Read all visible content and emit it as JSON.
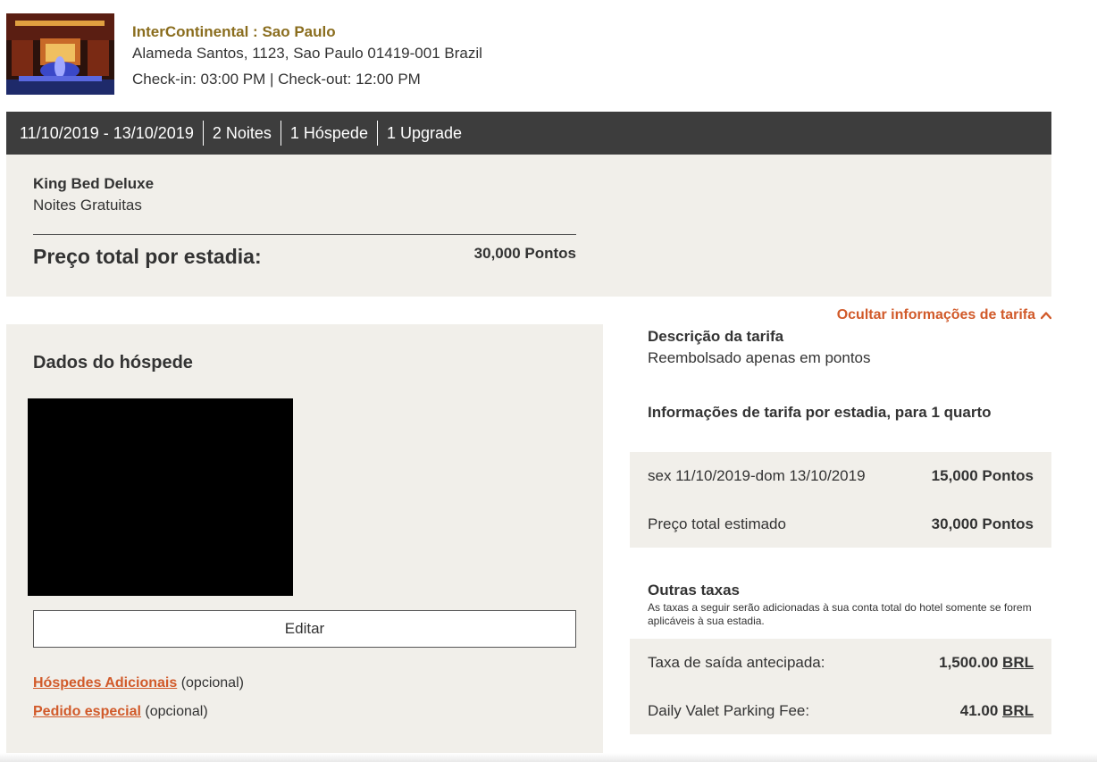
{
  "hotel": {
    "name": "InterContinental : Sao Paulo",
    "address": "Alameda Santos, 1123, Sao Paulo 01419-001 Brazil",
    "times": "Check-in: 03:00 PM | Check-out: 12:00 PM"
  },
  "stay": {
    "dates": "11/10/2019 - 13/10/2019",
    "nights": "2 Noites",
    "guests": "1 Hóspede",
    "upgrade": "1 Upgrade"
  },
  "room": {
    "name": "King Bed Deluxe",
    "rate": "Noites Gratuitas",
    "total_label": "Preço total por estadia:",
    "total_value": "30,000 Pontos"
  },
  "guest": {
    "title": "Dados do hóspede",
    "edit_label": "Editar",
    "additional_link": "Hóspedes Adicionais",
    "additional_note": "(opcional)",
    "special_link": "Pedido especial",
    "special_note": "(opcional)"
  },
  "rate_info": {
    "toggle_label": "Ocultar informações de tarifa",
    "desc_title": "Descrição da tarifa",
    "desc_text": "Reembolsado apenas em pontos",
    "info_title": "Informações de tarifa por estadia, para 1 quarto",
    "rows": [
      {
        "label": "sex 11/10/2019-dom 13/10/2019",
        "value": "15,000 Pontos"
      },
      {
        "label": "Preço total estimado",
        "value": "30,000 Pontos"
      }
    ]
  },
  "fees": {
    "title": "Outras taxas",
    "note": "As taxas a seguir serão adicionadas à sua conta total do hotel somente se forem aplicáveis à sua estadia.",
    "rows": [
      {
        "label": "Taxa de saída antecipada:",
        "amount": "1,500.00",
        "currency": "BRL"
      },
      {
        "label": "Daily Valet Parking Fee:",
        "amount": "41.00",
        "currency": "BRL"
      }
    ]
  },
  "colors": {
    "brand_gold": "#8a6d1e",
    "link_orange": "#d15a2a",
    "bar_dark": "#3d3d3d",
    "panel_bg": "#f1efea"
  },
  "icons": {
    "toggle": "chevron-up-icon"
  }
}
